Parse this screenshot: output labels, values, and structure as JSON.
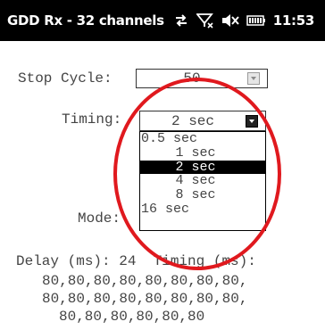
{
  "app": {
    "title": "GDD Rx - 32 channels",
    "clock": "11:53",
    "status_icons": [
      "connection-sync-icon",
      "signal-off-icon",
      "speaker-muted-icon",
      "battery-icon"
    ]
  },
  "form": {
    "stop_cycle": {
      "label": "Stop Cycle:",
      "value": "50"
    },
    "timing": {
      "label": "Timing:",
      "value": "2 sec",
      "options": [
        "0.5 sec",
        "1 sec",
        "2 sec",
        "4 sec",
        "8 sec",
        "16 sec"
      ],
      "selected": "2 sec"
    },
    "mode": {
      "label": "Mode:"
    },
    "delay_line": "Delay (ms): 24  Timing (ms):",
    "timing_values": [
      "80,80,80,80,80,80,80,80,",
      "80,80,80,80,80,80,80,80,",
      "80,80,80,80,80,80"
    ]
  },
  "colors": {
    "titlebar_bg": "#000000",
    "annotation": "#e0191e",
    "selection_bg": "#000000"
  }
}
